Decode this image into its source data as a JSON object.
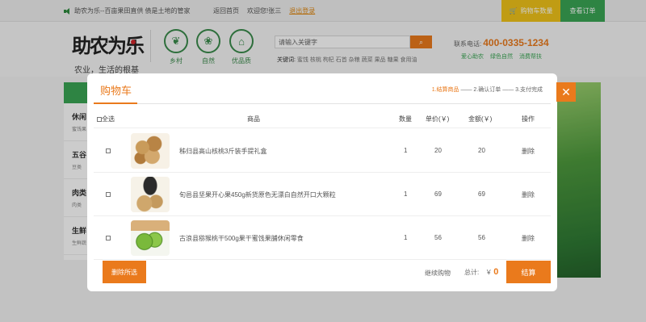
{
  "topbar": {
    "notice": "助农为乐--百亩果田直供 债是土地的管家",
    "links": [
      "返回首页",
      "欢迎您!张三",
      "退出登录"
    ],
    "cart_label": "购物车数量",
    "orders_label": "查看订单"
  },
  "header": {
    "logo": "助农为乐",
    "slogan": "农业，生活的根基",
    "categories": [
      {
        "label": "乡村",
        "icon": "wheat-icon"
      },
      {
        "label": "自然",
        "icon": "leaf-icon"
      },
      {
        "label": "优品质",
        "icon": "house-icon"
      }
    ],
    "search_placeholder": "请输入关键字",
    "keywords_label": "关键词:",
    "keywords": [
      "蜜饯",
      "核桃",
      "枸杞",
      "石首",
      "杂粮",
      "蔬菜",
      "果品",
      "糖果",
      "食用油"
    ],
    "phone_label": "联系电话:",
    "phone": "400-0335-1234",
    "promises": [
      "爱心助农",
      "绿色自然",
      "消费帮扶"
    ]
  },
  "leftmenu": [
    {
      "title": "休闲",
      "sub": "蜜饯果"
    },
    {
      "title": "五谷",
      "sub": "豆类"
    },
    {
      "title": "肉类",
      "sub": "肉类"
    },
    {
      "title": "生鲜",
      "sub": "生鲜蔬"
    }
  ],
  "cart": {
    "title": "购物车",
    "steps": [
      "1.结算商品",
      "2.确认订单",
      "3.支付完成"
    ],
    "columns": {
      "select_all": "全选",
      "product": "商品",
      "qty": "数量",
      "price": "单价(￥)",
      "amount": "金额(￥)",
      "action": "操作"
    },
    "items": [
      {
        "name": "秭归县高山核桃3斤装手提礼盒",
        "qty": "1",
        "price": "20",
        "amount": "20",
        "action": "删除",
        "image": "walnut-image"
      },
      {
        "name": "旬邑县坚果开心果450g新货原色无漂白自然开口大颗粒",
        "qty": "1",
        "price": "69",
        "amount": "69",
        "action": "删除",
        "image": "pistachio-image"
      },
      {
        "name": "古浪县猕猴桃干500g果干蜜饯果脯休闲零食",
        "qty": "1",
        "price": "56",
        "amount": "56",
        "action": "删除",
        "image": "kiwi-image"
      }
    ],
    "delete_selected": "删除所选",
    "continue_shopping": "继续购物",
    "total_label": "总计:",
    "currency": "￥",
    "total": "0",
    "checkout": "结算",
    "close": "✕"
  },
  "colors": {
    "accent": "#ea7a1c",
    "green": "#3aa654",
    "yellow": "#f0c419"
  }
}
